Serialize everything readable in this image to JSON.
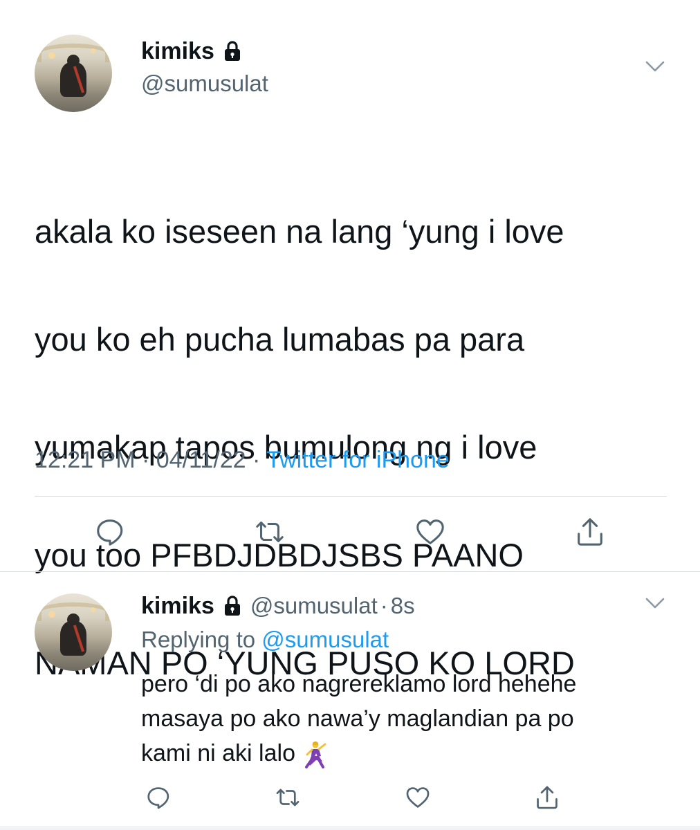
{
  "main_tweet": {
    "display_name": "kimiks",
    "handle": "@sumusulat",
    "text_lines": [
      "akala ko iseseen na lang ‘yung i love",
      "you ko eh pucha lumabas pa para",
      "yumakap tapos bumulong ng i love",
      "you too PFBDJDBDJSBS PAANO",
      "NAMAN PO ‘YUNG PUSO KO LORD"
    ],
    "time": "12:21 PM",
    "separator": "·",
    "date": "04/11/22",
    "source": "Twitter for iPhone"
  },
  "reply": {
    "display_name": "kimiks",
    "handle": "@sumusulat",
    "separator": "·",
    "age": "8s",
    "replying_prefix": "Replying to",
    "replying_to": "@sumusulat",
    "text_lines": [
      "pero ‘di po ako nagrereklamo lord hehehe",
      "masaya po ako nawa’y maglandian pa po",
      "kami ni aki lalo"
    ],
    "emoji": "dancing-woman"
  },
  "icons": {
    "lock": "lock-icon",
    "chevron": "chevron-down-icon",
    "reply": "comment-bubble-icon",
    "retweet": "retweet-icon",
    "like": "heart-icon",
    "share": "share-icon"
  },
  "colors": {
    "text": "#0f1419",
    "secondary": "#536471",
    "link": "#1d9bf0",
    "divider": "#d9dde0"
  }
}
